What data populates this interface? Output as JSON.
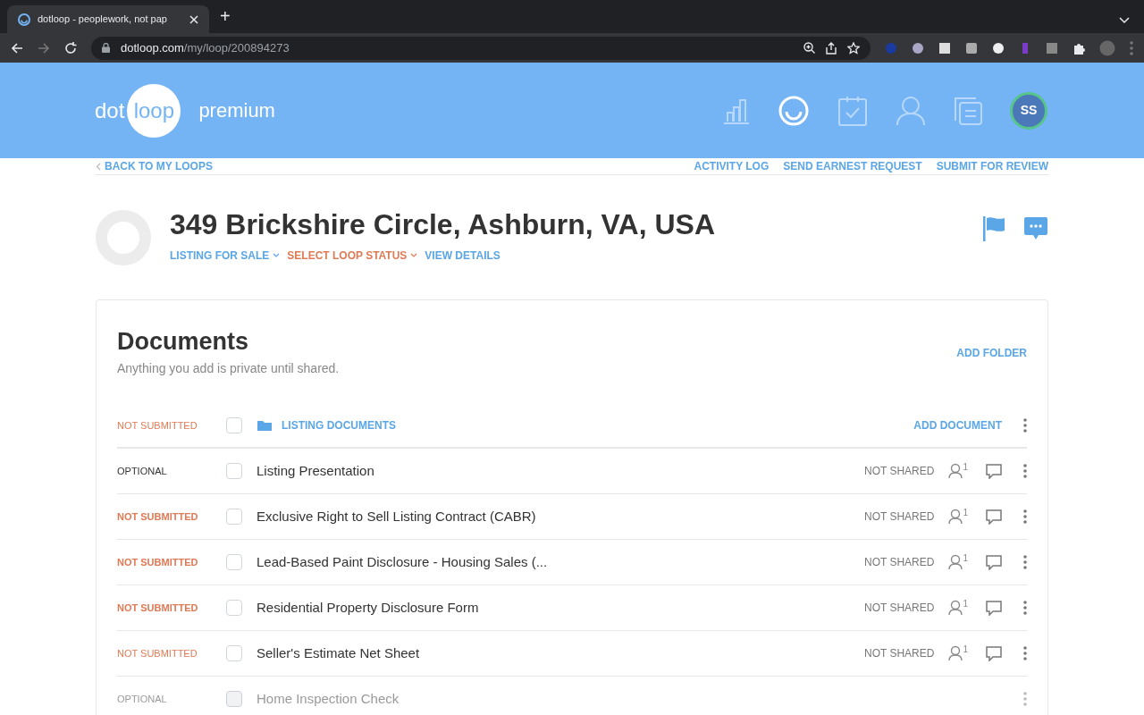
{
  "browser": {
    "tab_title": "dotloop - peoplework, not pap",
    "new_tab": "+",
    "url_host": "dotloop.com",
    "url_path": "/my/loop/200894273"
  },
  "header": {
    "logo_left": "dot",
    "logo_circle": "loop",
    "logo_suffix": "premium",
    "avatar": "SS"
  },
  "nav": {
    "back": "BACK TO MY LOOPS",
    "actions": [
      "ACTIVITY LOG",
      "SEND EARNEST REQUEST",
      "SUBMIT FOR REVIEW"
    ]
  },
  "loop": {
    "title": "349 Brickshire Circle, Ashburn, VA, USA",
    "links": [
      {
        "label": "LISTING FOR SALE",
        "kind": "dropdown",
        "color": "#5aa6e6"
      },
      {
        "label": "SELECT LOOP STATUS",
        "kind": "dropdown",
        "color": "#e07a55"
      },
      {
        "label": "VIEW DETAILS",
        "kind": "link",
        "color": "#5aa6e6"
      }
    ]
  },
  "documents": {
    "title": "Documents",
    "subtitle": "Anything you add is private until shared.",
    "add_folder": "ADD FOLDER",
    "folder": {
      "status": "NOT SUBMITTED",
      "checked": false,
      "name": "LISTING DOCUMENTS",
      "add_document": "ADD DOCUMENT"
    },
    "rows": [
      {
        "status": "OPTIONAL",
        "kind": "optional",
        "bold": false,
        "checked": false,
        "faded": false,
        "name": "Listing Presentation",
        "sharing": "NOT SHARED",
        "people": "1"
      },
      {
        "status": "NOT SUBMITTED",
        "kind": "not_submitted",
        "bold": true,
        "checked": false,
        "faded": false,
        "name": "Exclusive Right to Sell Listing Contract (CABR)",
        "sharing": "NOT SHARED",
        "people": "1"
      },
      {
        "status": "NOT SUBMITTED",
        "kind": "not_submitted",
        "bold": true,
        "checked": false,
        "faded": false,
        "name": "Lead-Based Paint Disclosure - Housing Sales (...",
        "sharing": "NOT SHARED",
        "people": "1"
      },
      {
        "status": "NOT SUBMITTED",
        "kind": "not_submitted",
        "bold": true,
        "checked": false,
        "faded": false,
        "name": "Residential Property Disclosure Form",
        "sharing": "NOT SHARED",
        "people": "1"
      },
      {
        "status": "NOT SUBMITTED",
        "kind": "not_submitted",
        "bold": false,
        "checked": false,
        "faded": false,
        "name": "Seller's Estimate Net Sheet",
        "sharing": "NOT SHARED",
        "people": "1"
      },
      {
        "status": "OPTIONAL",
        "kind": "optional",
        "bold": false,
        "checked": false,
        "name": "Home Inspection Check",
        "faded": true
      }
    ]
  }
}
